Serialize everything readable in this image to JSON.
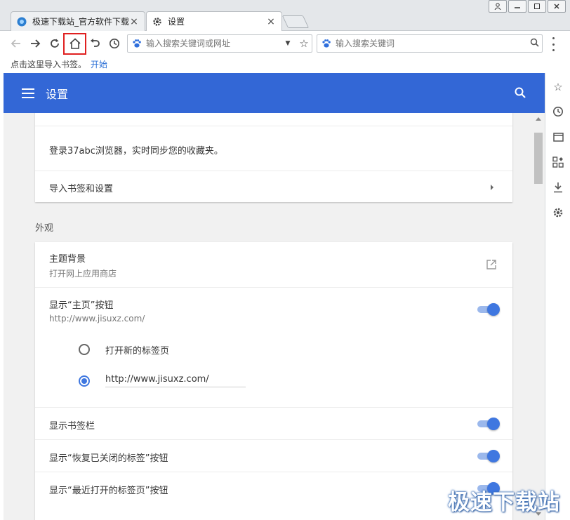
{
  "tabs": [
    {
      "title": "极速下载站_官方软件下载",
      "close": "×"
    },
    {
      "title": "设置",
      "close": "×"
    }
  ],
  "address": {
    "placeholder": "输入搜索关键词或网址"
  },
  "search": {
    "placeholder": "输入搜索关键词"
  },
  "bookmark_bar": {
    "text": "点击这里导入书签。",
    "link": "开始"
  },
  "header": {
    "title": "设置"
  },
  "account": {
    "sync_text": "登录37abc浏览器，实时同步您的收藏夹。",
    "import_label": "导入书签和设置"
  },
  "appearance": {
    "section_title": "外观",
    "theme": {
      "title": "主题背景",
      "sub": "打开网上应用商店"
    },
    "home": {
      "title": "显示“主页”按钮",
      "sub": "http://www.jisuxz.com/",
      "enabled": true
    },
    "home_options": [
      {
        "label": "打开新的标签页",
        "selected": false
      },
      {
        "label": "http://www.jisuxz.com/",
        "selected": true
      }
    ],
    "bookmarks_bar": {
      "title": "显示书签栏",
      "enabled": true
    },
    "restore_closed": {
      "title": "显示“恢复已关闭的标签”按钮",
      "enabled": true
    },
    "recent_tabs": {
      "title": "显示“最近打开的标签页”按钮",
      "enabled": true
    }
  },
  "colors": {
    "header": "#3367d6",
    "toggle": "#3f77e0",
    "highlight": "#e02020"
  },
  "watermark": "极速下载站"
}
